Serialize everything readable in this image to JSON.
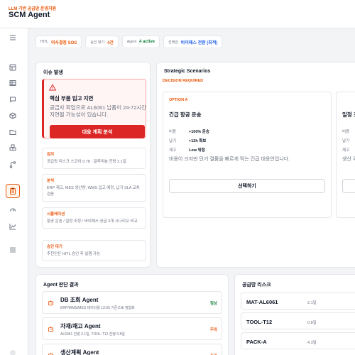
{
  "header": {
    "subtitle": "LLM 기반 공급망 운영지원",
    "title": "SCM Agent"
  },
  "sidebar": {
    "items": [
      {
        "icon": "dashboard-icon"
      },
      {
        "icon": "table-icon"
      },
      {
        "icon": "chat-icon"
      },
      {
        "icon": "cube-icon"
      },
      {
        "icon": "folder-icon"
      },
      {
        "icon": "boxes-icon"
      },
      {
        "icon": "branch-icon"
      },
      {
        "icon": "clipboard-icon",
        "active": true
      },
      {
        "icon": "gauge-icon"
      },
      {
        "icon": "chart-icon"
      },
      {
        "icon": "list-icon"
      }
    ]
  },
  "status": {
    "hitl_label": "HITL",
    "hitl_value": "의사결정 SOS",
    "approval_label": "승인 대기",
    "approval_value": "4건",
    "agent_label": "Agent",
    "agent_value": "4 active",
    "policy_label": "선택안",
    "policy_value": "바이패스 전환 (최적)"
  },
  "issue": {
    "title": "이슈 발생",
    "alert_title": "핵심 부품 입고 지연",
    "alert_body": "공급사 파업으로 AL6061 납품이 24-72시간 지연될 가능성이 있습니다.",
    "alert_button": "대응 계획 분석",
    "steps": [
      {
        "head": "감지",
        "body": "공급망 리스크 스코어 0.78 · 알루미늄 잔량 2.1일"
      },
      {
        "head": "분석",
        "body": "ERP 재고, MES 생산량, WMS 입고 예정, 납기 SLA 교차 검증"
      },
      {
        "head": "시뮬레이션",
        "body": "항공 운송 / 일정 조정 / 바이패스 공급 3개 시나리오 비교"
      },
      {
        "head": "승인 대기",
        "body": "추천안은 HITL 승인 후 실행 가능"
      }
    ]
  },
  "scenarios": {
    "title": "Strategic Scenarios",
    "decision_label": "DECISION REQUIRED",
    "option_a": {
      "tag": "OPTION A",
      "title": "긴급 항공 운송",
      "rows": [
        {
          "key": "비용",
          "value": "+100% 운송"
        },
        {
          "key": "납기",
          "value": "+12h 확보"
        },
        {
          "key": "재고",
          "value": "Low 위험"
        }
      ],
      "description": "비용이 크지만 단기 결품을 빠르게 막는 긴급 대응안입니다.",
      "button": "선택하기"
    },
    "option_b": {
      "title": "일정 조",
      "rows": [
        {
          "key": "비용"
        },
        {
          "key": "납기"
        },
        {
          "key": "재고"
        }
      ],
      "description": "생산 우"
    }
  },
  "agents": {
    "title": "Agent 판단 결과",
    "items": [
      {
        "name": "DB 조회 Agent",
        "desc": "ERP/WMS/MES 데이터를 12:03 기준으로 정합화",
        "status": "정상",
        "status_color": "#15803d"
      },
      {
        "name": "자재/재고 Agent",
        "desc": "AL6061 잔량 2.1일, TOOL-T12 잔량 0.8일",
        "status": "주의",
        "status_color": "#ea580c"
      },
      {
        "name": "생산계획 Agent",
        "desc": "",
        "status": "주의",
        "status_color": "#ea580c"
      }
    ]
  },
  "risk": {
    "title": "공급망 리스크",
    "items": [
      {
        "id": "MAT-AL6061",
        "value": "2.1일"
      },
      {
        "id": "TOOL-T12",
        "value": "0.8일"
      },
      {
        "id": "PACK-A",
        "value": "4.3일"
      }
    ]
  },
  "colors": {
    "accent": "#ea580c",
    "danger": "#dc2626",
    "ok": "#15803d",
    "info": "#2563eb"
  }
}
